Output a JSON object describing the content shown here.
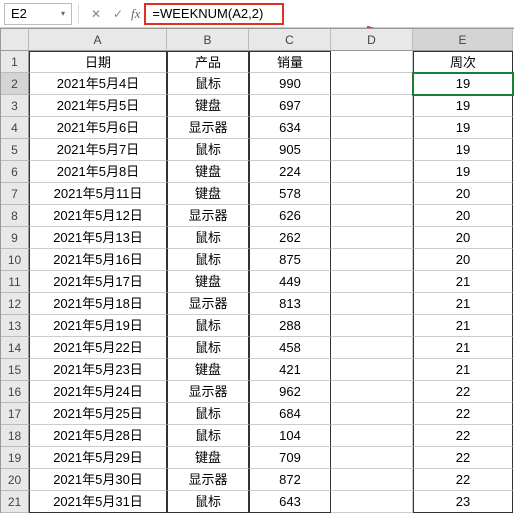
{
  "namebox": {
    "ref": "E2",
    "dropdown": "▾"
  },
  "fbar": {
    "cancel": "✕",
    "confirm": "✓",
    "fx": "fx",
    "formula": "=WEEKNUM(A2,2)"
  },
  "colHeaders": [
    "",
    "A",
    "B",
    "C",
    "D",
    "E"
  ],
  "activeCol": 5,
  "activeRow": 2,
  "headerRow": {
    "A": "日期",
    "B": "产品",
    "C": "销量",
    "D": "",
    "E": "周次"
  },
  "rows": [
    {
      "n": 2,
      "A": "2021年5月4日",
      "B": "鼠标",
      "C": "990",
      "D": "",
      "E": "19"
    },
    {
      "n": 3,
      "A": "2021年5月5日",
      "B": "键盘",
      "C": "697",
      "D": "",
      "E": "19"
    },
    {
      "n": 4,
      "A": "2021年5月6日",
      "B": "显示器",
      "C": "634",
      "D": "",
      "E": "19"
    },
    {
      "n": 5,
      "A": "2021年5月7日",
      "B": "鼠标",
      "C": "905",
      "D": "",
      "E": "19"
    },
    {
      "n": 6,
      "A": "2021年5月8日",
      "B": "键盘",
      "C": "224",
      "D": "",
      "E": "19"
    },
    {
      "n": 7,
      "A": "2021年5月11日",
      "B": "键盘",
      "C": "578",
      "D": "",
      "E": "20"
    },
    {
      "n": 8,
      "A": "2021年5月12日",
      "B": "显示器",
      "C": "626",
      "D": "",
      "E": "20"
    },
    {
      "n": 9,
      "A": "2021年5月13日",
      "B": "鼠标",
      "C": "262",
      "D": "",
      "E": "20"
    },
    {
      "n": 10,
      "A": "2021年5月16日",
      "B": "鼠标",
      "C": "875",
      "D": "",
      "E": "20"
    },
    {
      "n": 11,
      "A": "2021年5月17日",
      "B": "键盘",
      "C": "449",
      "D": "",
      "E": "21"
    },
    {
      "n": 12,
      "A": "2021年5月18日",
      "B": "显示器",
      "C": "813",
      "D": "",
      "E": "21"
    },
    {
      "n": 13,
      "A": "2021年5月19日",
      "B": "鼠标",
      "C": "288",
      "D": "",
      "E": "21"
    },
    {
      "n": 14,
      "A": "2021年5月22日",
      "B": "鼠标",
      "C": "458",
      "D": "",
      "E": "21"
    },
    {
      "n": 15,
      "A": "2021年5月23日",
      "B": "键盘",
      "C": "421",
      "D": "",
      "E": "21"
    },
    {
      "n": 16,
      "A": "2021年5月24日",
      "B": "显示器",
      "C": "962",
      "D": "",
      "E": "22"
    },
    {
      "n": 17,
      "A": "2021年5月25日",
      "B": "鼠标",
      "C": "684",
      "D": "",
      "E": "22"
    },
    {
      "n": 18,
      "A": "2021年5月28日",
      "B": "鼠标",
      "C": "104",
      "D": "",
      "E": "22"
    },
    {
      "n": 19,
      "A": "2021年5月29日",
      "B": "键盘",
      "C": "709",
      "D": "",
      "E": "22"
    },
    {
      "n": 20,
      "A": "2021年5月30日",
      "B": "显示器",
      "C": "872",
      "D": "",
      "E": "22"
    },
    {
      "n": 21,
      "A": "2021年5月31日",
      "B": "鼠标",
      "C": "643",
      "D": "",
      "E": "23"
    }
  ]
}
